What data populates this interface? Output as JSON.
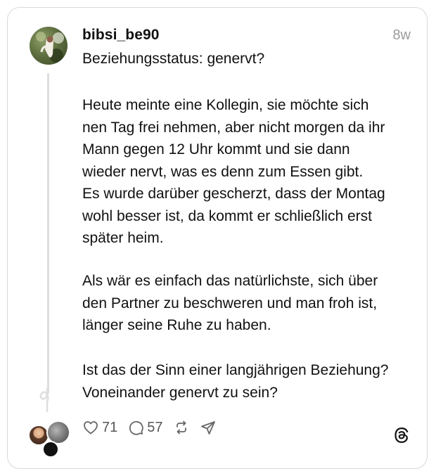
{
  "post": {
    "username": "bibsi_be90",
    "time_ago": "8w",
    "title": "Beziehungsstatus: genervt?",
    "paragraph_1": "Heute meinte eine Kollegin, sie möchte sich\nnen Tag frei nehmen, aber nicht morgen da ihr\nMann gegen 12 Uhr kommt und sie dann\nwieder nervt, was es denn zum Essen gibt.\nEs wurde darüber gescherzt, dass der Montag\nwohl besser ist, da kommt er schließlich erst\nspäter heim.",
    "paragraph_2": "Als wär es einfach das natürlichste, sich über\nden Partner zu beschweren und man froh ist,\nlänger seine Ruhe zu haben.",
    "paragraph_3": "Ist das der Sinn einer langjährigen Beziehung?\nVoneinander genervt zu sein?"
  },
  "actions": {
    "likes": "71",
    "replies": "57",
    "like_icon": "heart-icon",
    "reply_icon": "comment-icon",
    "repost_icon": "repost-icon",
    "share_icon": "send-icon"
  },
  "branding": {
    "logo_icon": "threads-logo-icon"
  },
  "colors": {
    "border": "#d9d9d9",
    "text": "#111111",
    "muted": "#9a9a9a",
    "icon": "#555555"
  }
}
